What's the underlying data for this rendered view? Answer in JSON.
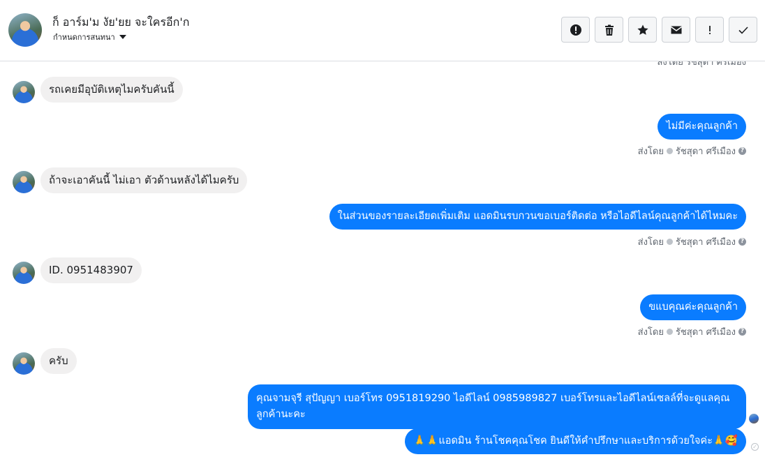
{
  "header": {
    "contact_name": "ก็ อาร์ม'ม งัย'ยย จะใครอีก'ก",
    "assign_label": "กำหนดการสนทนา",
    "toolbar": [
      "alert-icon",
      "trash-icon",
      "star-icon",
      "mail-icon",
      "exclamation-icon",
      "check-icon"
    ]
  },
  "sent_by": {
    "label": "ส่งโดย",
    "agent": "รัชสุดา ศรีเมือง"
  },
  "messages": [
    {
      "dir": "in",
      "text": "รถเคยมีอุบัติเหตุไมครับคันนี้"
    },
    {
      "dir": "out",
      "text": "ไม่มีค่ะคุณลูกค้า"
    },
    {
      "dir": "in",
      "text": "ถ้าจะเอาคันนี้  ไม่เอา  ตัวด้านหลังได้ไมครับ"
    },
    {
      "dir": "out",
      "text": "ในส่วนของรายละเอียดเพิ่มเติม แอดมินรบกวนขอเบอร์ติดต่อ หรือไอดีไลน์คุณลูกค้าได้ไหมคะ"
    },
    {
      "dir": "in",
      "text": "ID. 0951483907"
    },
    {
      "dir": "out",
      "text": "ขแบคุณค่ะคุณลูกค้า"
    },
    {
      "dir": "in",
      "text": "ครับ"
    },
    {
      "dir": "out",
      "text": "คุณจามจุรี สุปัญญา เบอร์โทร 0951819290  ไอดีไลน์ 0985989827   เบอร์โทรและไอดีไลน์เซลล์ที่จะดูแลคุณลูกค้านะคะ"
    },
    {
      "dir": "out",
      "text": "🙏🙏แอดมิน ร้านโชคคุณโชค ยินดีให้คำปรึกษาและบริการด้วยใจค่ะ🙏🥰"
    }
  ]
}
